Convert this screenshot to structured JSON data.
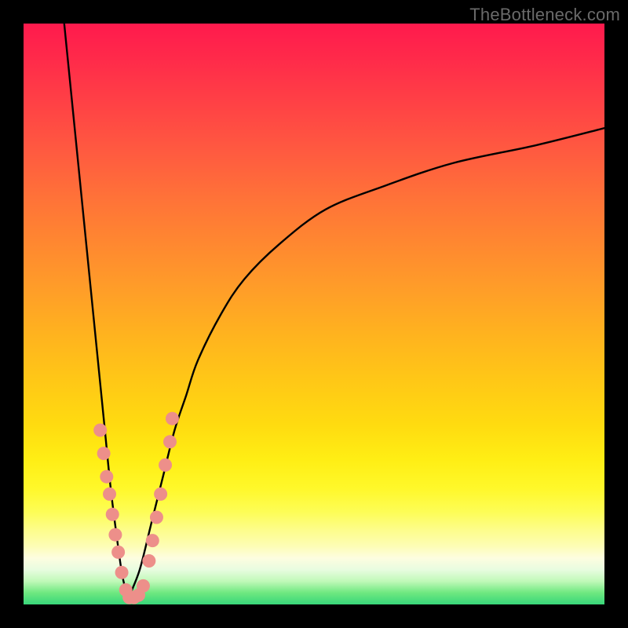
{
  "watermark": "TheBottleneck.com",
  "chart_data": {
    "type": "line",
    "title": "",
    "xlabel": "",
    "ylabel": "",
    "xlim": [
      0,
      100
    ],
    "ylim": [
      0,
      100
    ],
    "grid": false,
    "note": "Two curves descending into a V-shaped minimum near x≈18; left branch is steep, right branch rises asymptotically toward y≈82. Pink dot markers cluster on both branches near the minimum (y≲32).",
    "series": [
      {
        "name": "left-branch",
        "x": [
          7,
          8,
          9,
          10,
          11,
          12,
          13,
          14,
          15,
          16,
          17,
          18
        ],
        "y": [
          100,
          90,
          80,
          70,
          60,
          50,
          40,
          30,
          20,
          12,
          5,
          1
        ]
      },
      {
        "name": "right-branch",
        "x": [
          18,
          20,
          22,
          24,
          26,
          28,
          30,
          34,
          38,
          44,
          52,
          62,
          74,
          88,
          100
        ],
        "y": [
          1,
          6,
          14,
          22,
          30,
          36,
          42,
          50,
          56,
          62,
          68,
          72,
          76,
          79,
          82
        ]
      }
    ],
    "markers": {
      "name": "dots",
      "color": "#ed8f8a",
      "points": [
        {
          "x": 13.2,
          "y": 30
        },
        {
          "x": 13.8,
          "y": 26
        },
        {
          "x": 14.3,
          "y": 22
        },
        {
          "x": 14.8,
          "y": 19
        },
        {
          "x": 15.3,
          "y": 15.5
        },
        {
          "x": 15.8,
          "y": 12
        },
        {
          "x": 16.3,
          "y": 9
        },
        {
          "x": 16.9,
          "y": 5.5
        },
        {
          "x": 17.6,
          "y": 2.5
        },
        {
          "x": 18.2,
          "y": 1.2
        },
        {
          "x": 19.0,
          "y": 1.2
        },
        {
          "x": 19.8,
          "y": 1.6
        },
        {
          "x": 20.6,
          "y": 3.2
        },
        {
          "x": 21.6,
          "y": 7.5
        },
        {
          "x": 22.2,
          "y": 11
        },
        {
          "x": 22.9,
          "y": 15
        },
        {
          "x": 23.6,
          "y": 19
        },
        {
          "x": 24.4,
          "y": 24
        },
        {
          "x": 25.2,
          "y": 28
        },
        {
          "x": 25.6,
          "y": 32
        }
      ]
    }
  }
}
